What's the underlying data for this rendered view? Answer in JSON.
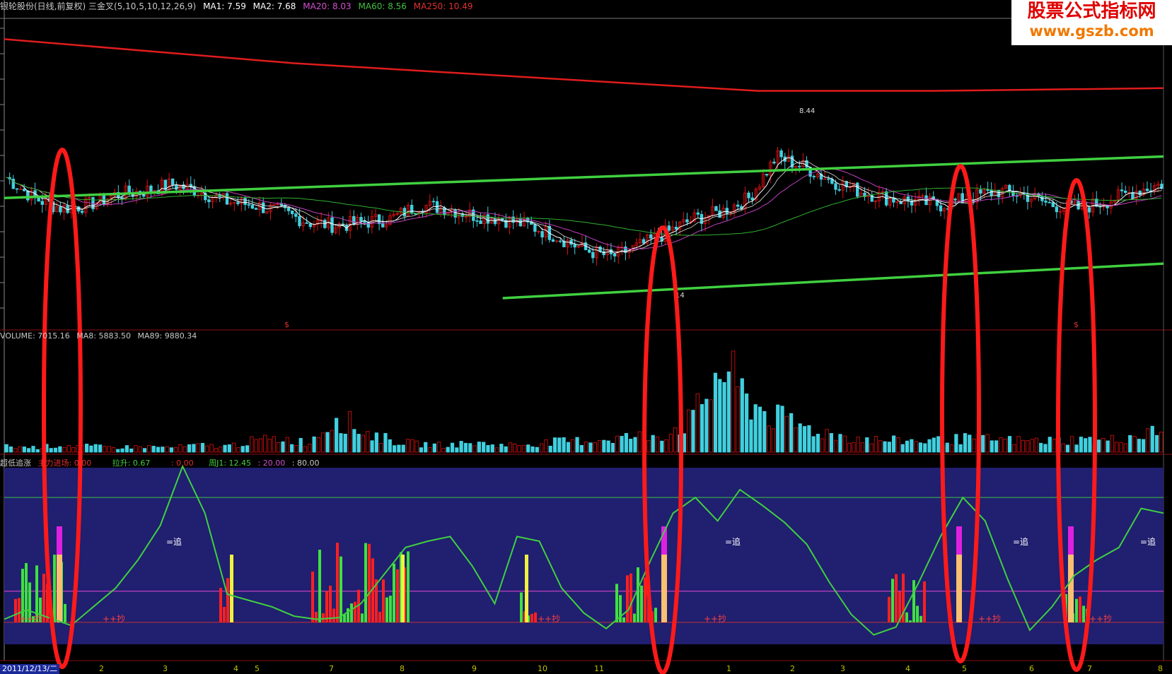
{
  "header": {
    "title": "银轮股份(日线,前复权) 三金叉(5,10,5,10,12,26,9)",
    "ma1": "MA1: 7.59",
    "ma2": "MA2: 7.68",
    "ma20": "MA20: 8.03",
    "ma60": "MA60: 8.56",
    "ma250": "MA250: 10.49"
  },
  "watermark": {
    "line1": "股票公式指标网",
    "line2": "www.gszb.com"
  },
  "volume_header": {
    "volume": "VOLUME: 7015.16",
    "ma8": "MA8: 5883.50",
    "ma89": "MA89: 9880.34"
  },
  "indicator_header": {
    "name": "超低追涨",
    "main": "主力进场: 0.00",
    "lift": "拉升: 0.67",
    "zero": ": 0.00",
    "j1": "周J1: 12.45",
    "l20": ": 20.00",
    "l80": ": 80.00"
  },
  "labels": {
    "high_price": "8.44",
    "low_price": "14",
    "dollar": "$",
    "chase": "=追",
    "buy": "++抄"
  },
  "x_axis": {
    "date": "2011/12/13/二",
    "ticks": [
      "2",
      "3",
      "4",
      "5",
      "7",
      "8",
      "9",
      "10",
      "11",
      "1",
      "2",
      "3",
      "4",
      "5",
      "6",
      "7",
      "8"
    ]
  },
  "colors": {
    "up": "#e01010",
    "down": "#40d0e0",
    "ma250": "#e01c1c",
    "ma60": "#30b030",
    "ma20": "#c040c0",
    "ma_fast": "#ffffff",
    "trend": "#40d040",
    "ring": "#ff1a1a",
    "indicator_bg": "#201f70",
    "j_line": "#40d040"
  },
  "chart_data": [
    {
      "type": "line",
      "title": "银轮股份 日线 MA250",
      "x": [
        0,
        0.25,
        0.5,
        0.65,
        0.8,
        1.0
      ],
      "series": [
        {
          "name": "MA250",
          "values": [
            11.2,
            10.85,
            10.6,
            10.45,
            10.45,
            10.49
          ]
        }
      ],
      "trendlines": [
        {
          "from": [
            0,
            8.9
          ],
          "to": [
            1,
            9.5
          ]
        },
        {
          "from": [
            0.43,
            7.45
          ],
          "to": [
            1,
            7.95
          ]
        }
      ],
      "price_path": [
        9.2,
        8.9,
        8.75,
        8.8,
        8.95,
        9.0,
        9.1,
        9.0,
        8.85,
        8.8,
        8.7,
        8.55,
        8.5,
        8.55,
        8.6,
        8.8,
        8.75,
        8.65,
        8.6,
        8.5,
        8.35,
        8.15,
        8.05,
        8.2,
        8.4,
        8.6,
        8.7,
        8.9,
        9.5,
        9.35,
        9.15,
        9.0,
        8.9,
        8.85,
        8.8,
        8.9,
        9.0,
        8.95,
        8.8,
        8.75,
        8.85,
        9.0,
        9.1
      ],
      "ylim": [
        7.0,
        11.5
      ]
    },
    {
      "type": "bar",
      "title": "VOLUME",
      "series": [
        {
          "name": "VOLUME",
          "values": [
            0.05,
            0.04,
            0.06,
            0.05,
            0.04,
            0.05,
            0.04,
            0.06,
            0.05,
            0.1,
            0.12,
            0.08,
            0.32,
            0.18,
            0.1,
            0.07,
            0.06,
            0.08,
            0.06,
            0.07,
            0.09,
            0.1,
            0.12,
            0.14,
            0.16,
            0.3,
            0.75,
            0.45,
            0.3,
            0.22,
            0.16,
            0.12,
            0.1,
            0.1,
            0.1,
            0.12,
            0.11,
            0.1,
            0.1,
            0.11,
            0.1,
            0.14,
            0.18
          ]
        }
      ],
      "ylim": [
        0,
        1
      ]
    },
    {
      "type": "line",
      "title": "超低追涨",
      "series": [
        {
          "name": "周J1",
          "values": [
            2,
            8,
            3,
            -2,
            10,
            22,
            40,
            62,
            100,
            70,
            18,
            14,
            10,
            4,
            2,
            3,
            12,
            30,
            48,
            52,
            55,
            36,
            12,
            55,
            52,
            22,
            6,
            -4,
            8,
            40,
            70,
            80,
            65,
            85,
            75,
            64,
            50,
            26,
            5,
            -8,
            -3,
            25,
            55,
            80,
            65,
            28,
            -5,
            10,
            30,
            40,
            48,
            73,
            70
          ]
        }
      ],
      "levels": [
        0,
        20,
        80
      ],
      "ylim": [
        -10,
        100
      ]
    }
  ]
}
